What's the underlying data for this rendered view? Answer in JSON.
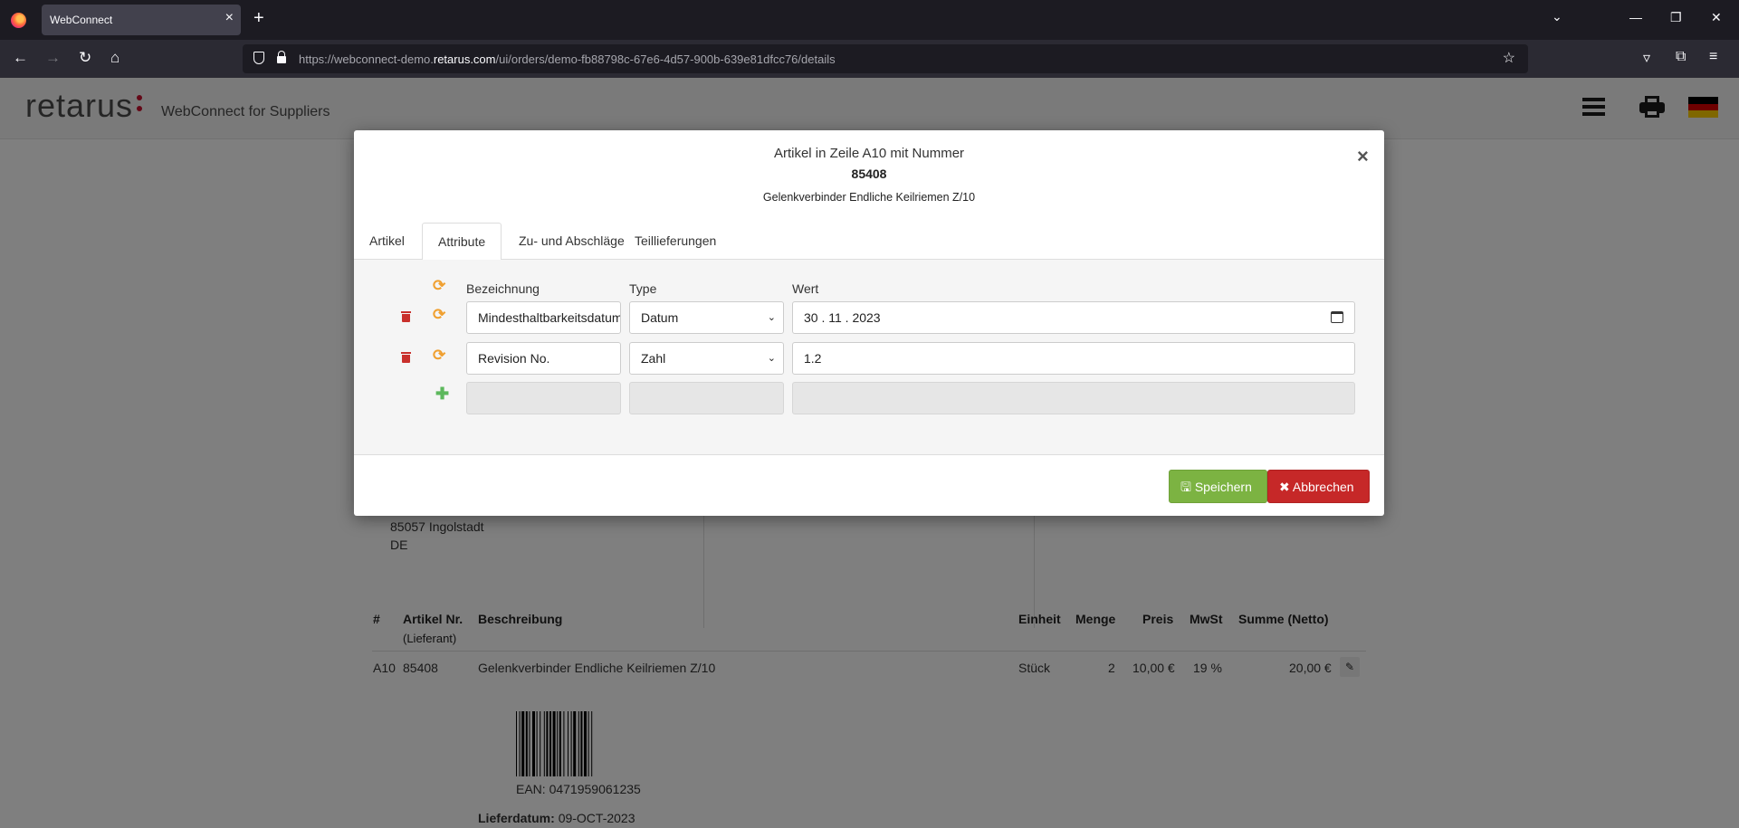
{
  "browser": {
    "tab_title": "WebConnect",
    "url_prefix": "https://webconnect-demo.",
    "url_domain": "retarus.com",
    "url_path": "/ui/orders/demo-fb88798c-67e6-4d57-900b-639e81dfcc76/details"
  },
  "header": {
    "logo": "retarus",
    "subtitle": "WebConnect for Suppliers",
    "flag_colors": [
      "#000000",
      "#dd0000",
      "#ffce00"
    ]
  },
  "order": {
    "address_city": "85057 Ingolstadt",
    "address_country": "DE",
    "columns": {
      "num": "#",
      "artnr": "Artikel Nr.",
      "artnr_sub": "(Lieferant)",
      "desc": "Beschreibung",
      "unit": "Einheit",
      "qty": "Menge",
      "price": "Preis",
      "vat": "MwSt",
      "sum": "Summe (Netto)"
    },
    "row": {
      "num": "A10",
      "artnr": "85408",
      "desc": "Gelenkverbinder Endliche Keilriemen Z/10",
      "unit": "Stück",
      "qty": "2",
      "price": "10,00 €",
      "vat": "19 %",
      "sum": "20,00 €",
      "ean_label": "EAN:",
      "ean": "0471959061235",
      "delivery_label": "Lieferdatum:",
      "delivery_date": "09-OCT-2023"
    }
  },
  "modal": {
    "title": "Artikel in Zeile A10 mit Nummer",
    "number": "85408",
    "description": "Gelenkverbinder Endliche Keilriemen Z/10",
    "close": "×",
    "tabs": [
      "Artikel",
      "Attribute",
      "Zu- und Abschläge",
      "Teillieferungen"
    ],
    "active_tab": "Attribute",
    "headers": {
      "name": "Bezeichnung",
      "type": "Type",
      "value": "Wert"
    },
    "attributes": [
      {
        "name": "Mindesthaltbarkeitsdatum",
        "type": "Datum",
        "value": "30 . 11 . 2023"
      },
      {
        "name": "Revision No.",
        "type": "Zahl",
        "value": "1.2"
      }
    ],
    "save": "Speichern",
    "cancel": "Abbrechen",
    "colors": {
      "save": "#7cb342",
      "cancel": "#c62828",
      "refresh": "#f0a030",
      "delete": "#c9302c",
      "add": "#5cb85c"
    }
  }
}
